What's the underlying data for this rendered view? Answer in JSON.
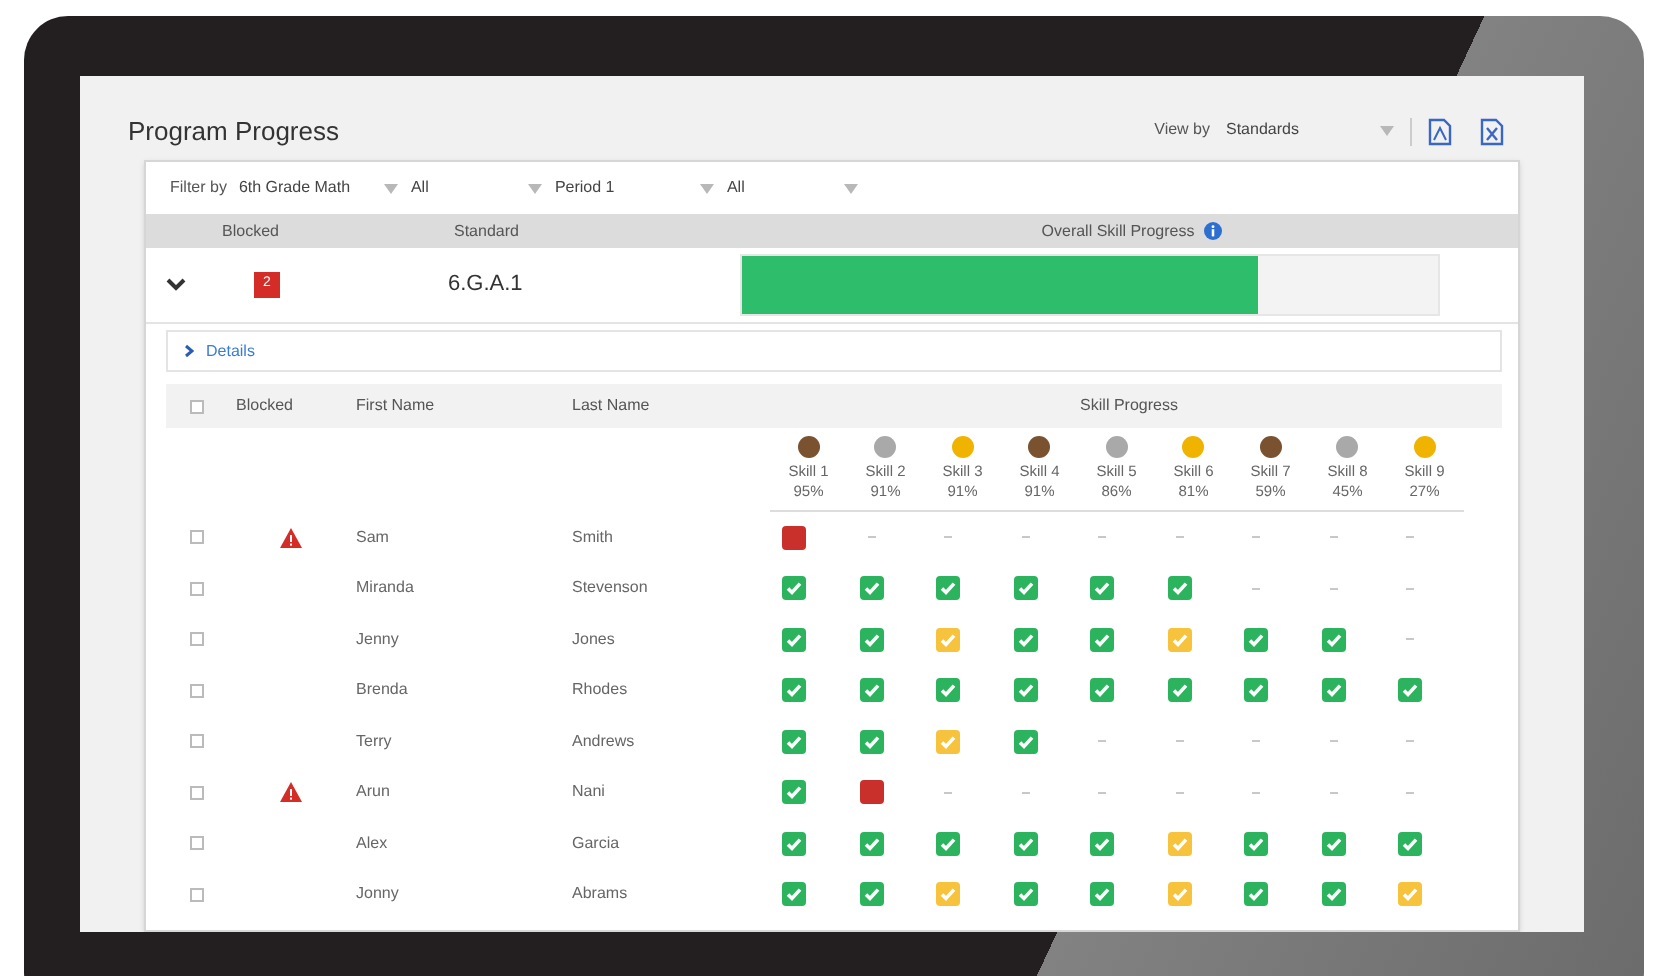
{
  "page": {
    "title": "Program Progress",
    "view_by_label": "View by",
    "view_by": "Standards"
  },
  "filters": {
    "label": "Filter by",
    "values": [
      "6th Grade Math",
      "All",
      "Period 1",
      "All"
    ]
  },
  "standards_table": {
    "columns": [
      "Blocked",
      "Standard",
      "Overall Skill Progress"
    ],
    "rows": [
      {
        "expanded": true,
        "blocked": "2",
        "standard": "6.G.A.1",
        "level": 0.74
      }
    ]
  },
  "details_link": {
    "label": "Details",
    "expanded": false
  },
  "students_table": {
    "columns": [
      "Blocked",
      "First Name",
      "Last Name",
      "Skill Progress"
    ],
    "select_all_checked": false,
    "skills": [
      {
        "name": "Skill 1",
        "percent": "95%",
        "color": "#7a5230"
      },
      {
        "name": "Skill 2",
        "percent": "91%",
        "color": "#a9a9a9"
      },
      {
        "name": "Skill 3",
        "percent": "91%",
        "color": "#f0b400"
      },
      {
        "name": "Skill 4",
        "percent": "91%",
        "color": "#7a5230"
      },
      {
        "name": "Skill 5",
        "percent": "86%",
        "color": "#a9a9a9"
      },
      {
        "name": "Skill 6",
        "percent": "81%",
        "color": "#f0b400"
      },
      {
        "name": "Skill 7",
        "percent": "59%",
        "color": "#7a5230"
      },
      {
        "name": "Skill 8",
        "percent": "45%",
        "color": "#a9a9a9"
      },
      {
        "name": "Skill 9",
        "percent": "27%",
        "color": "#f0b400"
      }
    ],
    "rows": [
      {
        "checked": false,
        "blocked": true,
        "first_name": "Sam",
        "last_name": "Smith",
        "skills": [
          {
            "kind": "fail"
          },
          {
            "kind": "none"
          },
          {
            "kind": "none"
          },
          {
            "kind": "none"
          },
          {
            "kind": "none"
          },
          {
            "kind": "none"
          },
          {
            "kind": "none"
          },
          {
            "kind": "none"
          },
          {
            "kind": "none"
          }
        ]
      },
      {
        "checked": false,
        "blocked": false,
        "first_name": "Miranda",
        "last_name": "Stevenson",
        "skills": [
          {
            "kind": "pass"
          },
          {
            "kind": "pass"
          },
          {
            "kind": "pass"
          },
          {
            "kind": "pass"
          },
          {
            "kind": "pass"
          },
          {
            "kind": "pass"
          },
          {
            "kind": "none"
          },
          {
            "kind": "none"
          },
          {
            "kind": "none"
          }
        ]
      },
      {
        "checked": false,
        "blocked": false,
        "first_name": "Jenny",
        "last_name": "Jones",
        "skills": [
          {
            "kind": "pass"
          },
          {
            "kind": "pass"
          },
          {
            "kind": "partial"
          },
          {
            "kind": "pass"
          },
          {
            "kind": "pass"
          },
          {
            "kind": "partial"
          },
          {
            "kind": "pass"
          },
          {
            "kind": "pass"
          },
          {
            "kind": "none"
          }
        ]
      },
      {
        "checked": false,
        "blocked": false,
        "first_name": "Brenda",
        "last_name": "Rhodes",
        "skills": [
          {
            "kind": "pass"
          },
          {
            "kind": "pass"
          },
          {
            "kind": "pass"
          },
          {
            "kind": "pass"
          },
          {
            "kind": "pass"
          },
          {
            "kind": "pass"
          },
          {
            "kind": "pass"
          },
          {
            "kind": "pass"
          },
          {
            "kind": "pass"
          }
        ]
      },
      {
        "checked": false,
        "blocked": false,
        "first_name": "Terry",
        "last_name": "Andrews",
        "skills": [
          {
            "kind": "pass"
          },
          {
            "kind": "pass"
          },
          {
            "kind": "partial"
          },
          {
            "kind": "pass"
          },
          {
            "kind": "none"
          },
          {
            "kind": "none"
          },
          {
            "kind": "none"
          },
          {
            "kind": "none"
          },
          {
            "kind": "none"
          }
        ]
      },
      {
        "checked": false,
        "blocked": true,
        "first_name": "Arun",
        "last_name": "Nani",
        "skills": [
          {
            "kind": "pass"
          },
          {
            "kind": "fail"
          },
          {
            "kind": "none"
          },
          {
            "kind": "none"
          },
          {
            "kind": "none"
          },
          {
            "kind": "none"
          },
          {
            "kind": "none"
          },
          {
            "kind": "none"
          },
          {
            "kind": "none"
          }
        ]
      },
      {
        "checked": false,
        "blocked": false,
        "first_name": "Alex",
        "last_name": "Garcia",
        "skills": [
          {
            "kind": "pass"
          },
          {
            "kind": "pass"
          },
          {
            "kind": "pass"
          },
          {
            "kind": "pass"
          },
          {
            "kind": "pass"
          },
          {
            "kind": "partial"
          },
          {
            "kind": "pass"
          },
          {
            "kind": "pass"
          },
          {
            "kind": "pass"
          }
        ]
      },
      {
        "checked": false,
        "blocked": false,
        "first_name": "Jonny",
        "last_name": "Abrams",
        "skills": [
          {
            "kind": "pass"
          },
          {
            "kind": "pass"
          },
          {
            "kind": "partial"
          },
          {
            "kind": "pass"
          },
          {
            "kind": "pass"
          },
          {
            "kind": "partial"
          },
          {
            "kind": "pass"
          },
          {
            "kind": "pass"
          },
          {
            "kind": "partial"
          }
        ]
      }
    ]
  }
}
